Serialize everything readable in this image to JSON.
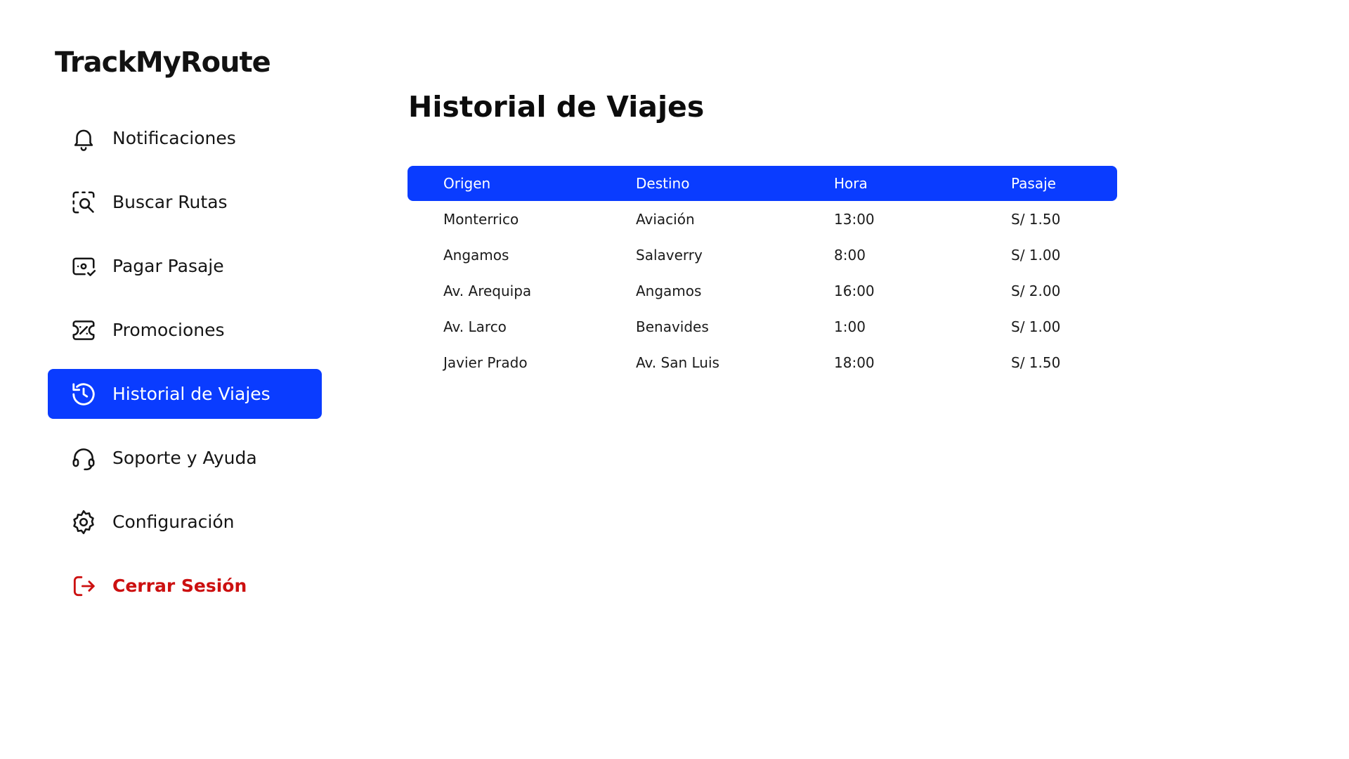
{
  "app": {
    "logo_text": "TrackMyRoute"
  },
  "sidebar": {
    "items": [
      {
        "label": "Notificaciones",
        "icon": "bell-icon"
      },
      {
        "label": "Buscar Rutas",
        "icon": "scan-search-icon"
      },
      {
        "label": "Pagar Pasaje",
        "icon": "ticket-check-icon"
      },
      {
        "label": "Promociones",
        "icon": "discount-ticket-icon"
      },
      {
        "label": "Historial de Viajes",
        "icon": "history-icon",
        "active": true
      },
      {
        "label": "Soporte y Ayuda",
        "icon": "headset-icon"
      },
      {
        "label": "Configuración",
        "icon": "settings-icon"
      },
      {
        "label": "Cerrar Sesión",
        "icon": "logout-icon"
      }
    ]
  },
  "main": {
    "title": "Historial de Viajes",
    "table": {
      "headers": [
        "Origen",
        "Destino",
        "Hora",
        "Pasaje"
      ],
      "rows": [
        [
          "Monterrico",
          "Aviación",
          "13:00",
          "S/ 1.50"
        ],
        [
          "Angamos",
          "Salaverry",
          "8:00",
          "S/ 1.00"
        ],
        [
          "Av. Arequipa",
          "Angamos",
          "16:00",
          "S/ 2.00"
        ],
        [
          "Av. Larco",
          "Benavides",
          "1:00",
          "S/ 1.00"
        ],
        [
          "Javier Prado",
          "Av. San Luis",
          "18:00",
          "S/ 1.50"
        ]
      ]
    }
  },
  "colors": {
    "accent": "#0a3cff",
    "logout": "#cc1010",
    "text": "#151515"
  }
}
